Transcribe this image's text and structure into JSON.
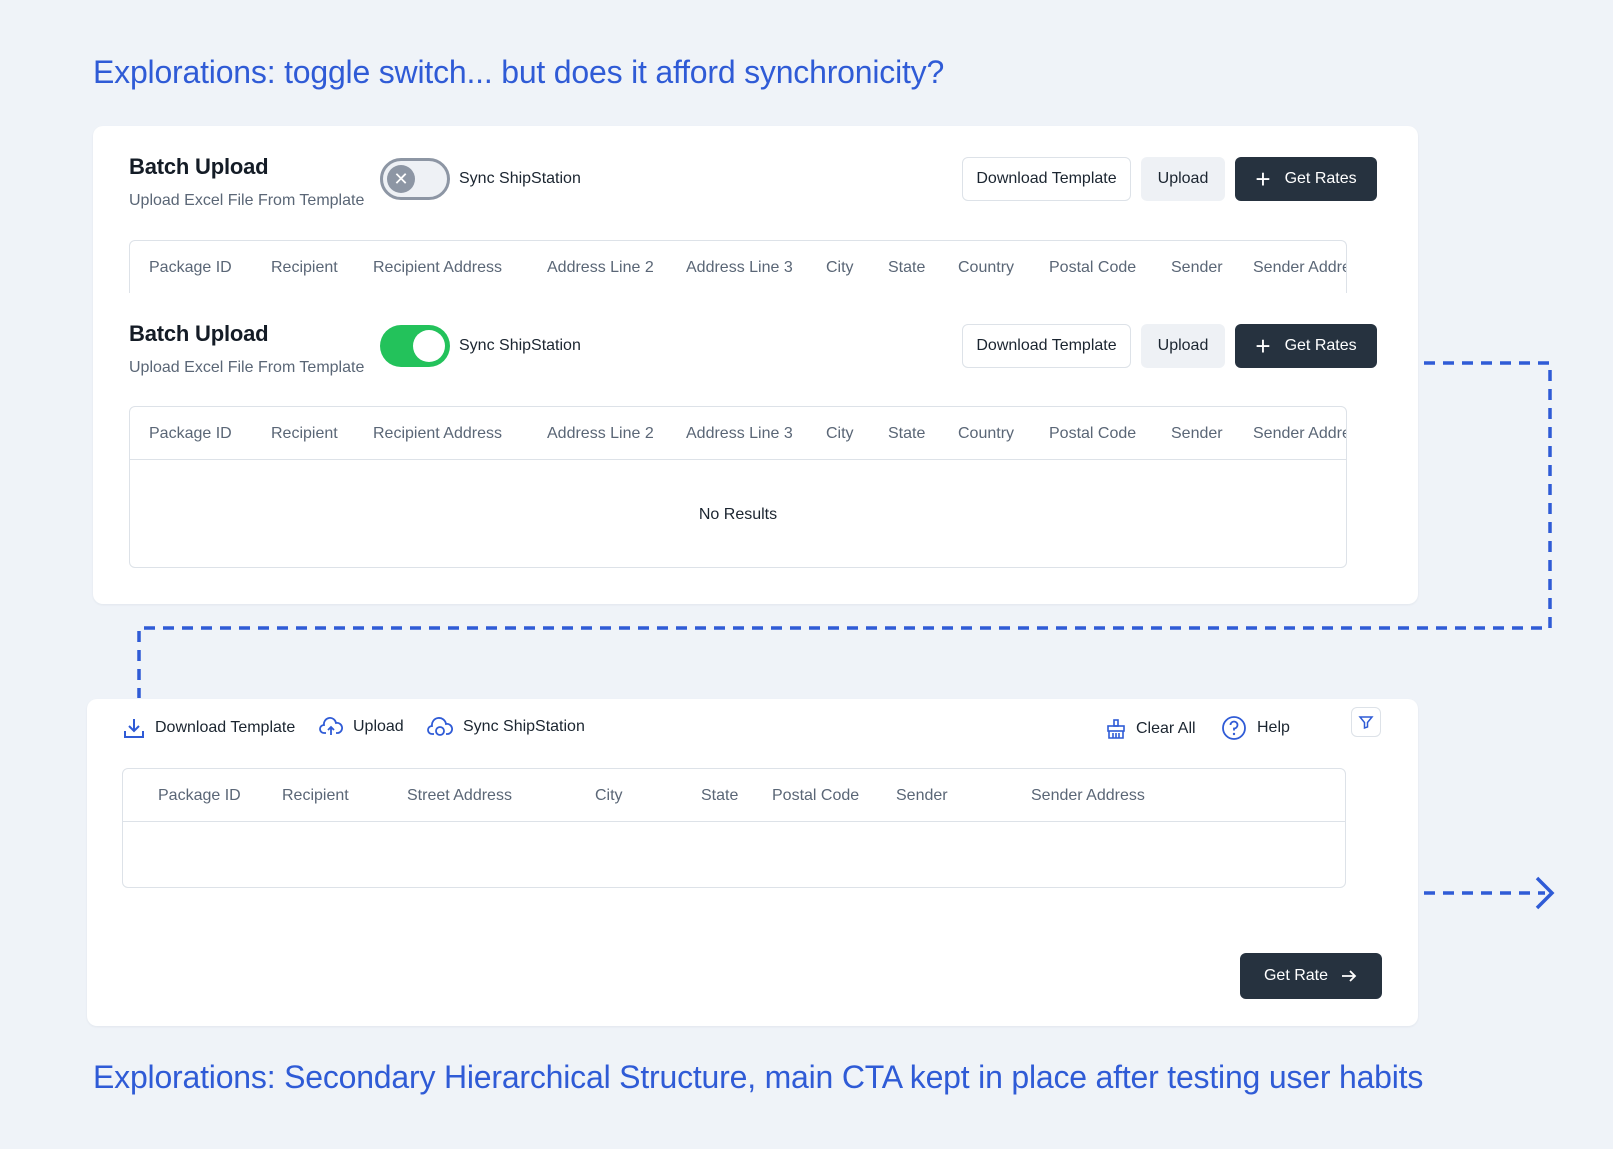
{
  "captions": {
    "top": "Explorations: toggle switch... but does it afford synchronicity?",
    "bottom": "Explorations: Secondary Hierarchical Structure, main CTA kept in place after testing user habits"
  },
  "colors": {
    "background": "#eff3f8",
    "caption": "#2f5bd6",
    "toggle_on": "#23c25b",
    "toggle_off": "#8d96a4",
    "primary_button": "#26323f",
    "connector": "#2f5bd6"
  },
  "variant_off": {
    "title": "Batch Upload",
    "subtitle": "Upload Excel File From Template",
    "toggle_state": "off",
    "toggle_label": "Sync ShipStation",
    "buttons": {
      "download_template": "Download Template",
      "upload": "Upload",
      "get_rates": "Get Rates"
    },
    "columns": [
      "Package ID",
      "Recipient",
      "Recipient Address",
      "Address Line 2",
      "Address Line 3",
      "City",
      "State",
      "Country",
      "Postal Code",
      "Sender",
      "Sender Address"
    ]
  },
  "variant_on": {
    "title": "Batch Upload",
    "subtitle": "Upload Excel File From Template",
    "toggle_state": "on",
    "toggle_label": "Sync ShipStation",
    "buttons": {
      "download_template": "Download Template",
      "upload": "Upload",
      "get_rates": "Get Rates"
    },
    "columns": [
      "Package ID",
      "Recipient",
      "Recipient Address",
      "Address Line 2",
      "Address Line 3",
      "City",
      "State",
      "Country",
      "Postal Code",
      "Sender",
      "Sender Address"
    ],
    "empty_text": "No Results"
  },
  "secondary": {
    "toolbar": {
      "download_template": "Download Template",
      "upload": "Upload",
      "sync": "Sync ShipStation",
      "clear_all": "Clear All",
      "help": "Help"
    },
    "columns": [
      "Package ID",
      "Recipient",
      "Street Address",
      "City",
      "State",
      "Postal Code",
      "Sender",
      "Sender Address"
    ],
    "cta": "Get Rate"
  }
}
